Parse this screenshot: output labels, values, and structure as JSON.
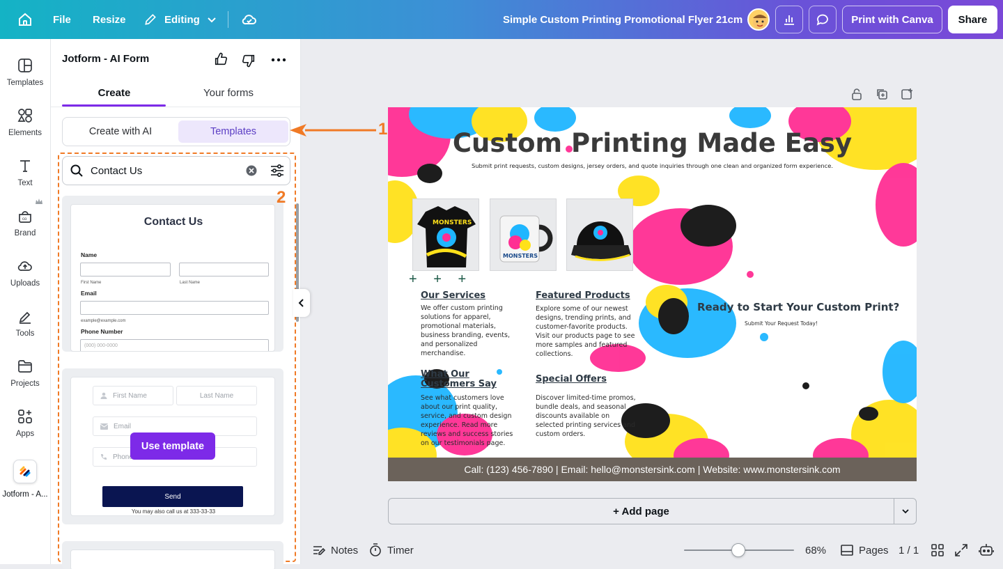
{
  "topbar": {
    "file": "File",
    "resize": "Resize",
    "editing": "Editing",
    "doc_title": "Simple Custom Printing Promotional Flyer 21cm",
    "print_btn": "Print with Canva",
    "share_btn": "Share"
  },
  "rail": {
    "items": [
      {
        "label": "Templates",
        "icon": "templates-icon"
      },
      {
        "label": "Elements",
        "icon": "elements-icon"
      },
      {
        "label": "Text",
        "icon": "text-icon"
      },
      {
        "label": "Brand",
        "icon": "brand-icon"
      },
      {
        "label": "Uploads",
        "icon": "uploads-icon"
      },
      {
        "label": "Tools",
        "icon": "tools-icon"
      },
      {
        "label": "Projects",
        "icon": "projects-icon"
      },
      {
        "label": "Apps",
        "icon": "apps-icon"
      },
      {
        "label": "Jotform - A...",
        "icon": "jotform-icon"
      }
    ]
  },
  "panel": {
    "title": "Jotform - AI Form",
    "tab_create": "Create",
    "tab_forms": "Your forms",
    "seg_ai": "Create with AI",
    "seg_templates": "Templates",
    "search_value": "Contact Us",
    "callout_1": "1",
    "callout_2": "2",
    "card1": {
      "title": "Contact Us",
      "name_label": "Name",
      "first": "First Name",
      "last": "Last Name",
      "email_label": "Email",
      "email_hint": "example@example.com",
      "phone_label": "Phone Number",
      "phone_placeholder": "(000) 000-0000"
    },
    "card2": {
      "first": "First Name",
      "last": "Last Name",
      "email": "Email",
      "phone": "Phone",
      "use_template": "Use template",
      "send": "Send",
      "note": "You may also call us at 333-33-33"
    }
  },
  "flyer": {
    "title": "Custom Printing Made Easy",
    "subtitle": "Submit print requests, custom designs, jersey orders, and quote inquiries through one clean and organized form experience.",
    "plus_marks": "+ + +",
    "services_h": "Our Services",
    "services_p": "We offer custom printing solutions for apparel, promotional materials, business branding, events, and personalized merchandise.",
    "featured_h": "Featured Products",
    "featured_p": "Explore some of our newest designs, trending prints, and customer-favorite products. Visit our products page to see more samples and featured collections.",
    "customers_h": "What Our Customers Say",
    "customers_p": "See what customers love about our print quality, service, and custom design experience. Read more reviews and success stories on our testimonials page.",
    "offers_h": "Special Offers",
    "offers_p": "Discover limited-time promos, bundle deals, and seasonal discounts available on selected printing services and custom orders.",
    "ready_h": "Ready to Start Your Custom Print?",
    "ready_sub": "Submit Your Request Today!",
    "footer": "Call: (123) 456-7890 | Email: hello@monstersink.com | Website: www.monstersink.com",
    "logo_text": "MONSTERS Ink"
  },
  "canvas": {
    "add_page": "+ Add page"
  },
  "bottombar": {
    "notes": "Notes",
    "timer": "Timer",
    "zoom": "68%",
    "pages": "Pages",
    "page_count": "1 / 1"
  },
  "colors": {
    "accent": "#7d2ae8",
    "callout": "#f07a26",
    "footer": "#6b625a"
  }
}
